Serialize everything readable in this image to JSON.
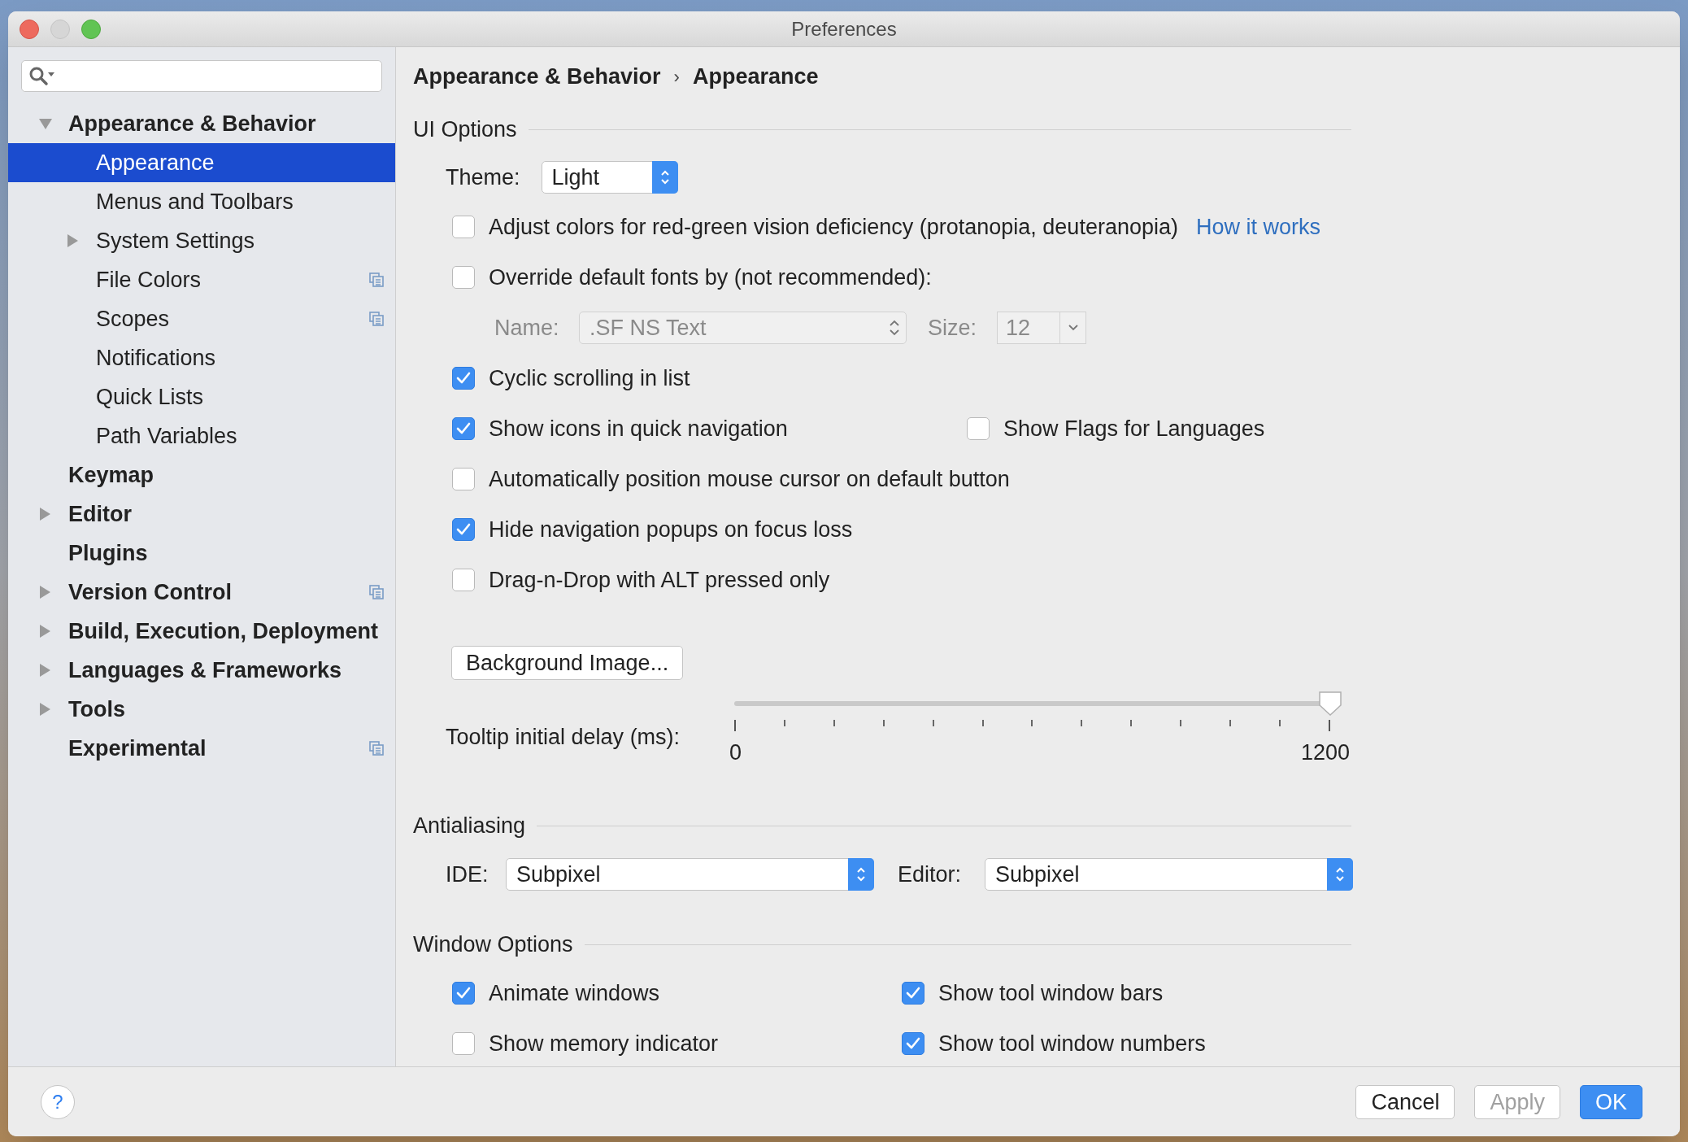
{
  "window": {
    "title": "Preferences"
  },
  "sidebar": {
    "items": [
      {
        "label": "Appearance & Behavior",
        "expanded": true,
        "selected": false,
        "has_icon": false,
        "children": [
          {
            "label": "Appearance",
            "selected": true,
            "has_icon": false
          },
          {
            "label": "Menus and Toolbars",
            "selected": false,
            "has_icon": false
          },
          {
            "label": "System Settings",
            "expanded": false,
            "selected": false,
            "has_icon": false
          },
          {
            "label": "File Colors",
            "selected": false,
            "has_icon": true
          },
          {
            "label": "Scopes",
            "selected": false,
            "has_icon": true
          },
          {
            "label": "Notifications",
            "selected": false,
            "has_icon": false
          },
          {
            "label": "Quick Lists",
            "selected": false,
            "has_icon": false
          },
          {
            "label": "Path Variables",
            "selected": false,
            "has_icon": false
          }
        ]
      },
      {
        "label": "Keymap",
        "selected": false,
        "has_icon": false
      },
      {
        "label": "Editor",
        "expanded": false,
        "selected": false,
        "has_icon": false
      },
      {
        "label": "Plugins",
        "selected": false,
        "has_icon": false
      },
      {
        "label": "Version Control",
        "expanded": false,
        "selected": false,
        "has_icon": true
      },
      {
        "label": "Build, Execution, Deployment",
        "expanded": false,
        "selected": false,
        "has_icon": false
      },
      {
        "label": "Languages & Frameworks",
        "expanded": false,
        "selected": false,
        "has_icon": false
      },
      {
        "label": "Tools",
        "expanded": false,
        "selected": false,
        "has_icon": false
      },
      {
        "label": "Experimental",
        "selected": false,
        "has_icon": true
      }
    ]
  },
  "breadcrumb": {
    "items": [
      "Appearance & Behavior",
      "Appearance"
    ],
    "separator": "›"
  },
  "sections": [
    {
      "title": "UI Options",
      "rows": [
        {
          "kind": "select",
          "label": "Theme:",
          "value": "Light"
        },
        {
          "kind": "checkbox",
          "label": "Adjust colors for red-green vision deficiency (protanopia, deuteranopia)",
          "checked": false,
          "link": "How it works"
        },
        {
          "kind": "checkbox",
          "label": "Override default fonts by (not recommended):",
          "checked": false
        },
        {
          "kind": "font",
          "disabled": true,
          "name_label": "Name:",
          "name_value": ".SF NS Text",
          "size_label": "Size:",
          "size_value": "12"
        },
        {
          "kind": "checkbox",
          "label": "Cyclic scrolling in list",
          "checked": true
        },
        {
          "kind": "checkbox_pair",
          "items": [
            {
              "label": "Show icons in quick navigation",
              "checked": true
            },
            {
              "label": "Show Flags for Languages",
              "checked": false
            }
          ]
        },
        {
          "kind": "checkbox",
          "label": "Automatically position mouse cursor on default button",
          "checked": false
        },
        {
          "kind": "checkbox",
          "label": "Hide navigation popups on focus loss",
          "checked": true
        },
        {
          "kind": "checkbox",
          "label": "Drag-n-Drop with ALT pressed only",
          "checked": false
        },
        {
          "kind": "button",
          "label": "Background Image..."
        },
        {
          "kind": "slider",
          "label": "Tooltip initial delay (ms):",
          "level": 1,
          "min_label": "0",
          "max_label": "1200"
        }
      ]
    },
    {
      "title": "Antialiasing",
      "rows": [
        {
          "kind": "select_pair",
          "items": [
            {
              "label": "IDE:",
              "value": "Subpixel"
            },
            {
              "label": "Editor:",
              "value": "Subpixel"
            }
          ]
        }
      ]
    },
    {
      "title": "Window Options",
      "rows": [
        {
          "kind": "checkbox_pair",
          "items": [
            {
              "label": "Animate windows",
              "checked": true
            },
            {
              "label": "Show tool window bars",
              "checked": true
            }
          ]
        },
        {
          "kind": "checkbox_pair",
          "items": [
            {
              "label": "Show memory indicator",
              "checked": false
            },
            {
              "label": "Show tool window numbers",
              "checked": true
            }
          ]
        }
      ]
    }
  ],
  "footer": {
    "help": "?",
    "buttons": [
      {
        "label": "Cancel",
        "kind": "normal",
        "disabled": false
      },
      {
        "label": "Apply",
        "kind": "normal",
        "disabled": true
      },
      {
        "label": "OK",
        "kind": "default",
        "disabled": false
      }
    ]
  }
}
